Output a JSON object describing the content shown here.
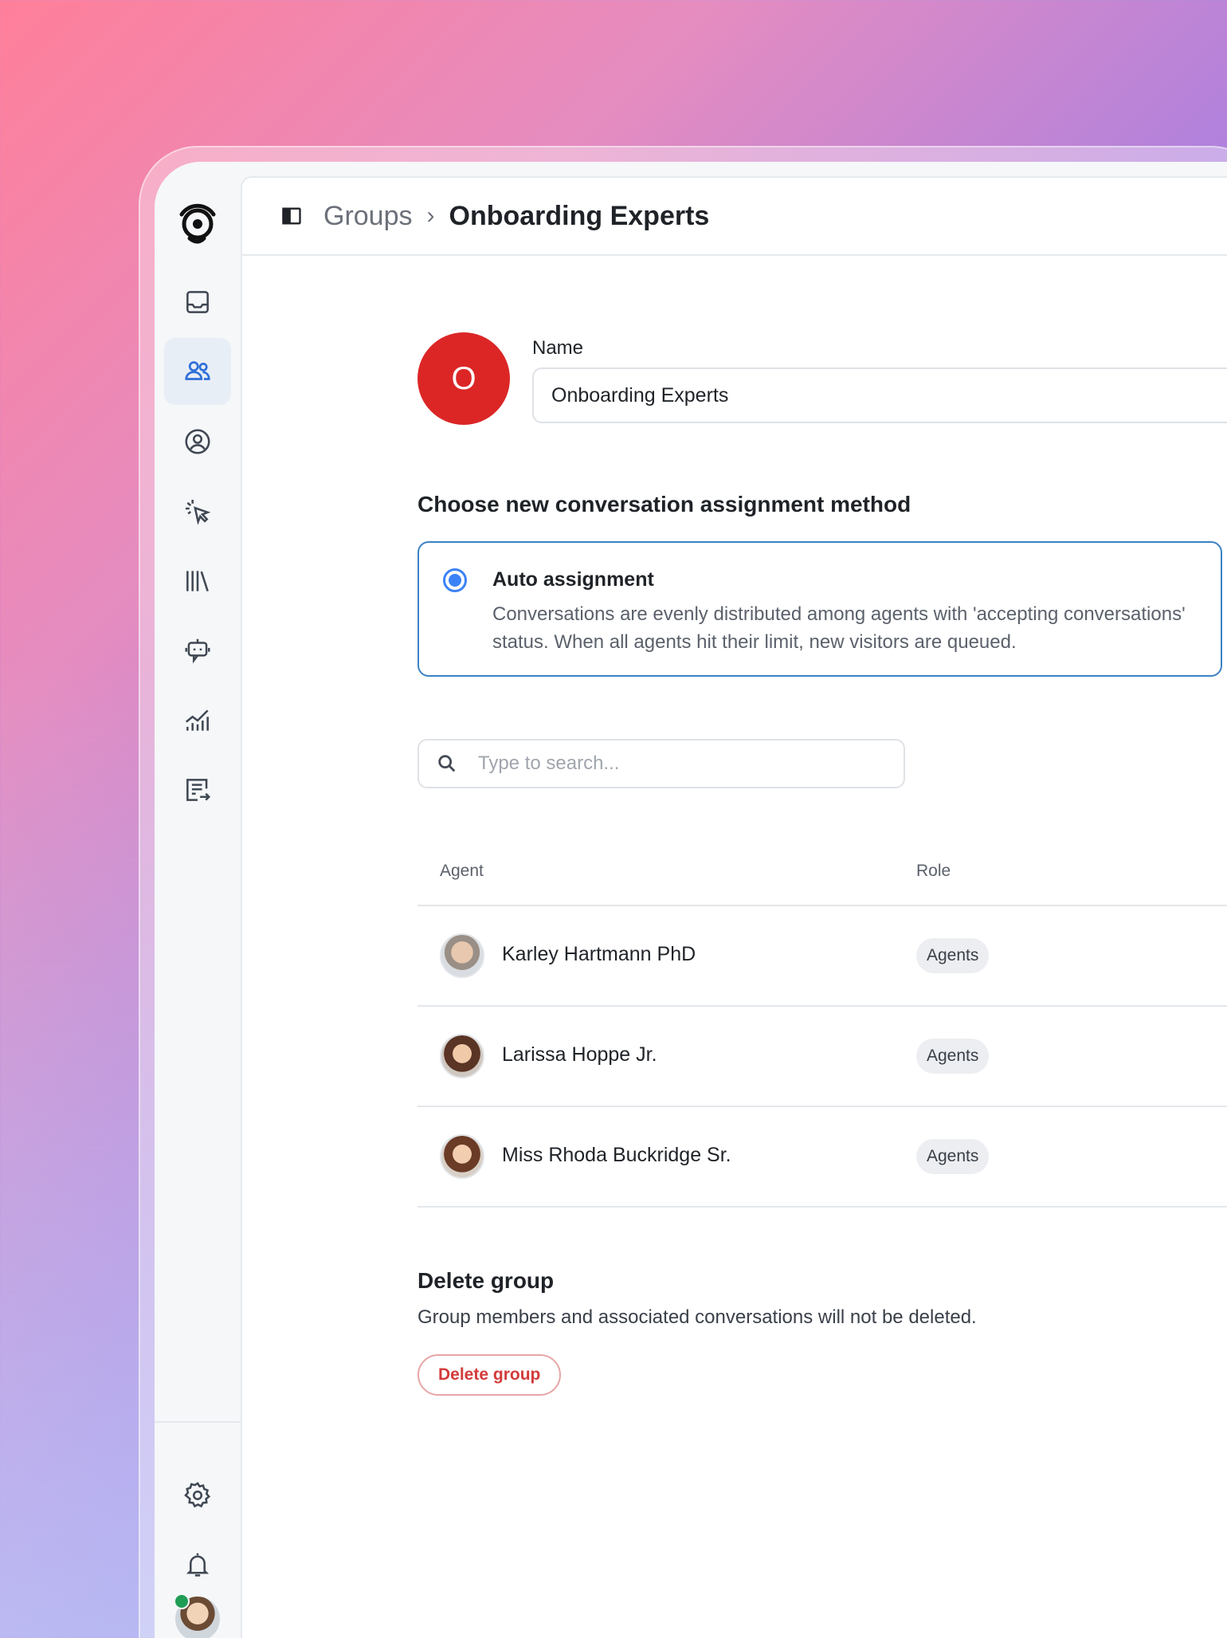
{
  "breadcrumb": {
    "parent": "Groups",
    "separator": "›",
    "current": "Onboarding Experts"
  },
  "sidebar": {
    "items": [
      {
        "icon": "inbox-icon",
        "active": false
      },
      {
        "icon": "users-icon",
        "active": true
      },
      {
        "icon": "contact-icon",
        "active": false
      },
      {
        "icon": "cursor-click-icon",
        "active": false
      },
      {
        "icon": "library-icon",
        "active": false
      },
      {
        "icon": "bot-icon",
        "active": false
      },
      {
        "icon": "analytics-icon",
        "active": false
      },
      {
        "icon": "reply-list-icon",
        "active": false
      }
    ],
    "bottom": [
      {
        "icon": "gear-icon"
      },
      {
        "icon": "bell-icon"
      }
    ],
    "user_status": "online"
  },
  "group": {
    "avatar_letter": "O",
    "avatar_color": "#dc2626",
    "name_label": "Name",
    "name_value": "Onboarding Experts"
  },
  "assignment": {
    "section_title": "Choose new conversation assignment method",
    "option_title": "Auto assignment",
    "option_description": "Conversations are evenly distributed among agents with 'accepting conversations' status. When all agents hit their limit, new visitors are queued.",
    "selected": true,
    "accent_color": "#3b82f6"
  },
  "search": {
    "placeholder": "Type to search..."
  },
  "table": {
    "columns": [
      "Agent",
      "Role"
    ],
    "rows": [
      {
        "name": "Karley Hartmann PhD",
        "role": "Agents"
      },
      {
        "name": "Larissa Hoppe Jr.",
        "role": "Agents"
      },
      {
        "name": "Miss Rhoda Buckridge Sr.",
        "role": "Agents"
      }
    ]
  },
  "delete": {
    "title": "Delete group",
    "description": "Group members and associated conversations will not be deleted.",
    "button_label": "Delete group",
    "button_color": "#d33b3b"
  }
}
